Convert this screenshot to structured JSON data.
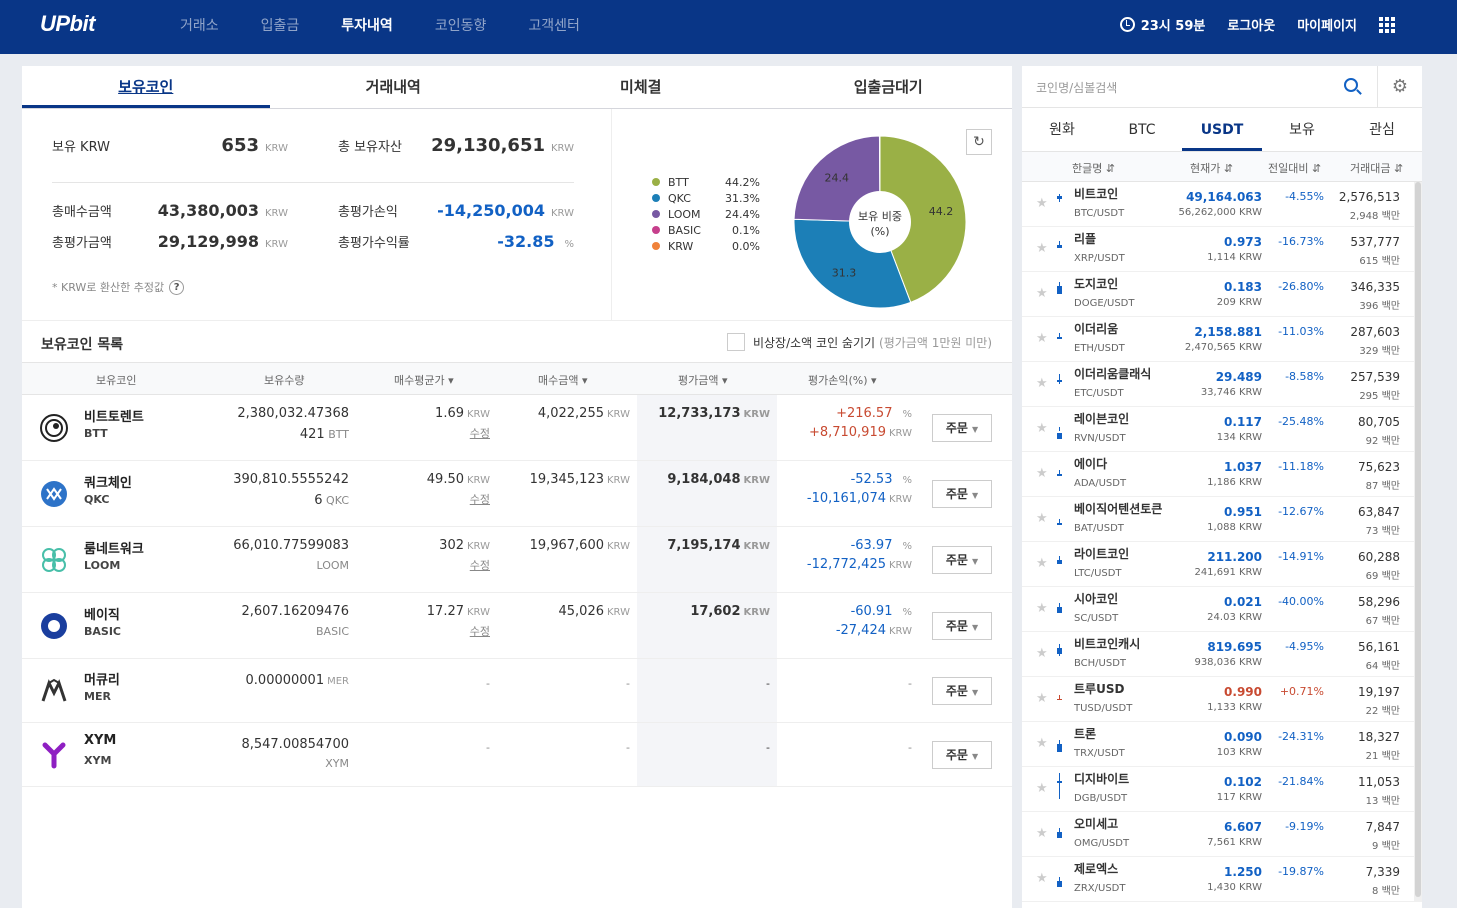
{
  "header": {
    "logo": "UPbit",
    "nav": [
      "거래소",
      "입출금",
      "투자내역",
      "코인동향",
      "고객센터"
    ],
    "time": "23시 59분",
    "logout": "로그아웃",
    "mypage": "마이페이지"
  },
  "tabs": [
    "보유코인",
    "거래내역",
    "미체결",
    "입출금대기"
  ],
  "summary": {
    "krw_label": "보유 KRW",
    "krw_value": "653",
    "total_assets_label": "총 보유자산",
    "total_assets_value": "29,130,651",
    "buy_label": "총매수금액",
    "buy_value": "43,380,003",
    "eval_pl_label": "총평가손익",
    "eval_pl_value": "-14,250,004",
    "eval_label": "총평가금액",
    "eval_value": "29,129,998",
    "rate_label": "총평가수익률",
    "rate_value": "-32.85",
    "unit": "KRW",
    "pct": "%",
    "note": "* KRW로 환산한 추정값",
    "help": "?"
  },
  "chart_data": {
    "type": "pie",
    "title": "보유 비중 (%)",
    "categories": [
      "BTT",
      "QKC",
      "LOOM",
      "BASIC",
      "KRW"
    ],
    "values": [
      44.2,
      31.3,
      24.4,
      0.1,
      0.0
    ],
    "colors": [
      "#9ab046",
      "#1c7fb7",
      "#7759a3",
      "#c63f8c",
      "#f0823a"
    ],
    "labels": [
      "44.2%",
      "31.3%",
      "24.4%",
      "0.1%",
      "0.0%"
    ],
    "slice_labels": [
      "44.2",
      "31.3",
      "24.4",
      "",
      ""
    ]
  },
  "list": {
    "title": "보유코인 목록",
    "hide_label": "비상장/소액 코인 숨기기",
    "hide_sub": "(평가금액 1만원 미만)",
    "columns": [
      "보유코인",
      "보유수량",
      "매수평균가",
      "매수금액",
      "평가금액",
      "평가손익(%)"
    ],
    "order_label": "주문",
    "adjust_label": "수정",
    "rows": [
      {
        "name": "비트토렌트",
        "symbol": "BTT",
        "qty": "2,380,032.47368",
        "qty_sub": "421",
        "qty_sub_unit": "BTT",
        "avg": "1.69",
        "avg_unit": "KRW",
        "buy": "4,022,255",
        "buy_unit": "KRW",
        "eval": "12,733,173",
        "eval_unit": "KRW",
        "rate": "+216.57",
        "rate_unit": "%",
        "pl": "+8,710,919",
        "pl_unit": "KRW"
      },
      {
        "name": "쿼크체인",
        "symbol": "QKC",
        "qty": "390,810.5555242",
        "qty_sub": "6",
        "qty_sub_unit": "QKC",
        "avg": "49.50",
        "avg_unit": "KRW",
        "buy": "19,345,123",
        "buy_unit": "KRW",
        "eval": "9,184,048",
        "eval_unit": "KRW",
        "rate": "-52.53",
        "rate_unit": "%",
        "pl": "-10,161,074",
        "pl_unit": "KRW"
      },
      {
        "name": "룸네트워크",
        "symbol": "LOOM",
        "qty": "66,010.77599083",
        "qty_sub": "",
        "qty_sub_unit": "LOOM",
        "avg": "302",
        "avg_unit": "KRW",
        "buy": "19,967,600",
        "buy_unit": "KRW",
        "eval": "7,195,174",
        "eval_unit": "KRW",
        "rate": "-63.97",
        "rate_unit": "%",
        "pl": "-12,772,425",
        "pl_unit": "KRW"
      },
      {
        "name": "베이직",
        "symbol": "BASIC",
        "qty": "2,607.16209476",
        "qty_sub": "",
        "qty_sub_unit": "BASIC",
        "avg": "17.27",
        "avg_unit": "KRW",
        "buy": "45,026",
        "buy_unit": "KRW",
        "eval": "17,602",
        "eval_unit": "KRW",
        "rate": "-60.91",
        "rate_unit": "%",
        "pl": "-27,424",
        "pl_unit": "KRW"
      },
      {
        "name": "머큐리",
        "symbol": "MER",
        "qty": "0.00000001",
        "qty_unit": "MER",
        "dash": "-"
      },
      {
        "name": "XYM",
        "symbol": "XYM",
        "qty": "8,547.00854700",
        "qty_sub": "",
        "qty_sub_unit": "XYM",
        "dash": "-"
      }
    ]
  },
  "market": {
    "search_placeholder": "코인명/심볼검색",
    "tabs": [
      "원화",
      "BTC",
      "USDT",
      "보유",
      "관심"
    ],
    "columns": [
      "한글명",
      "현재가",
      "전일대비",
      "거래대금"
    ],
    "vol_unit": "백만",
    "krw_unit": "KRW",
    "rows": [
      {
        "name": "비트코인",
        "symbol": "BTC/USDT",
        "price": "49,164.063",
        "krw": "56,262,000",
        "change": "-4.55%",
        "vol": "2,576,513",
        "vol2": "2,948"
      },
      {
        "name": "리플",
        "symbol": "XRP/USDT",
        "price": "0.973",
        "krw": "1,114",
        "change": "-16.73%",
        "vol": "537,777",
        "vol2": "615"
      },
      {
        "name": "도지코인",
        "symbol": "DOGE/USDT",
        "price": "0.183",
        "krw": "209",
        "change": "-26.80%",
        "vol": "346,335",
        "vol2": "396"
      },
      {
        "name": "이더리움",
        "symbol": "ETH/USDT",
        "price": "2,158.881",
        "krw": "2,470,565",
        "change": "-11.03%",
        "vol": "287,603",
        "vol2": "329"
      },
      {
        "name": "이더리움클래식",
        "symbol": "ETC/USDT",
        "price": "29.489",
        "krw": "33,746",
        "change": "-8.58%",
        "vol": "257,539",
        "vol2": "295"
      },
      {
        "name": "레이븐코인",
        "symbol": "RVN/USDT",
        "price": "0.117",
        "krw": "134",
        "change": "-25.48%",
        "vol": "80,705",
        "vol2": "92"
      },
      {
        "name": "에이다",
        "symbol": "ADA/USDT",
        "price": "1.037",
        "krw": "1,186",
        "change": "-11.18%",
        "vol": "75,623",
        "vol2": "87"
      },
      {
        "name": "베이직어텐션토큰",
        "symbol": "BAT/USDT",
        "price": "0.951",
        "krw": "1,088",
        "change": "-12.67%",
        "vol": "63,847",
        "vol2": "73"
      },
      {
        "name": "라이트코인",
        "symbol": "LTC/USDT",
        "price": "211.200",
        "krw": "241,691",
        "change": "-14.91%",
        "vol": "60,288",
        "vol2": "69"
      },
      {
        "name": "시아코인",
        "symbol": "SC/USDT",
        "price": "0.021",
        "krw": "24.03",
        "change": "-40.00%",
        "vol": "58,296",
        "vol2": "67"
      },
      {
        "name": "비트코인캐시",
        "symbol": "BCH/USDT",
        "price": "819.695",
        "krw": "938,036",
        "change": "-4.95%",
        "vol": "56,161",
        "vol2": "64"
      },
      {
        "name": "트루USD",
        "symbol": "TUSD/USDT",
        "price": "0.990",
        "krw": "1,133",
        "change": "+0.71%",
        "vol": "19,197",
        "vol2": "22"
      },
      {
        "name": "트론",
        "symbol": "TRX/USDT",
        "price": "0.090",
        "krw": "103",
        "change": "-24.31%",
        "vol": "18,327",
        "vol2": "21"
      },
      {
        "name": "디지바이트",
        "symbol": "DGB/USDT",
        "price": "0.102",
        "krw": "117",
        "change": "-21.84%",
        "vol": "11,053",
        "vol2": "13"
      },
      {
        "name": "오미세고",
        "symbol": "OMG/USDT",
        "price": "6.607",
        "krw": "7,561",
        "change": "-9.19%",
        "vol": "7,847",
        "vol2": "9"
      },
      {
        "name": "제로엑스",
        "symbol": "ZRX/USDT",
        "price": "1.250",
        "krw": "1,430",
        "change": "-19.87%",
        "vol": "7,339",
        "vol2": "8"
      }
    ]
  }
}
